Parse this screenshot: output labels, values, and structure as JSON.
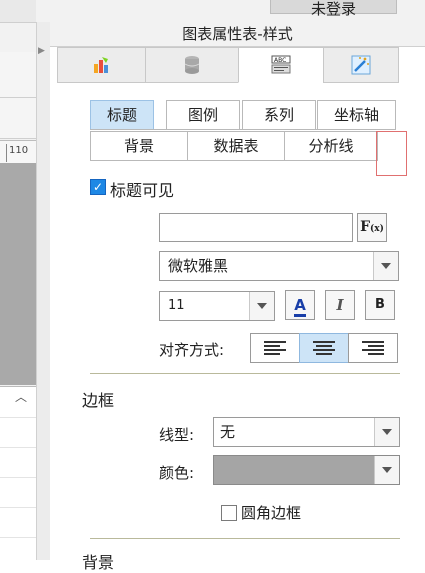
{
  "top": {
    "login_label": "未登录"
  },
  "left": {
    "ruler_value": "110"
  },
  "panel": {
    "title": "图表属性表-样式",
    "icon_tabs": [
      {
        "name": "chart-type-icon"
      },
      {
        "name": "database-icon"
      },
      {
        "name": "style-icon"
      },
      {
        "name": "effects-icon"
      }
    ],
    "sub_tabs_row1": [
      "标题",
      "图例",
      "系列",
      "坐标轴"
    ],
    "sub_tabs_row2": [
      "背景",
      "数据表",
      "分析线"
    ],
    "active_sub_tab": "标题"
  },
  "title_section": {
    "visible_label": "标题可见",
    "visible_checked": true,
    "title_value": "",
    "fx_label": "F",
    "fx_sub": "(x)",
    "font_family": "微软雅黑",
    "font_size": "11",
    "color_button": "A",
    "italic_button": "I",
    "bold_button": "B",
    "align_label": "对齐方式:"
  },
  "border_section": {
    "heading": "边框",
    "line_type_label": "线型:",
    "line_type_value": "无",
    "color_label": "颜色:",
    "color_value": "#a5a5a5",
    "round_corner_label": "圆角边框",
    "round_corner_checked": false
  },
  "background_section": {
    "heading": "背景"
  },
  "colors": {
    "accent": "#1e88e5",
    "active_tab": "#cde4f7"
  }
}
